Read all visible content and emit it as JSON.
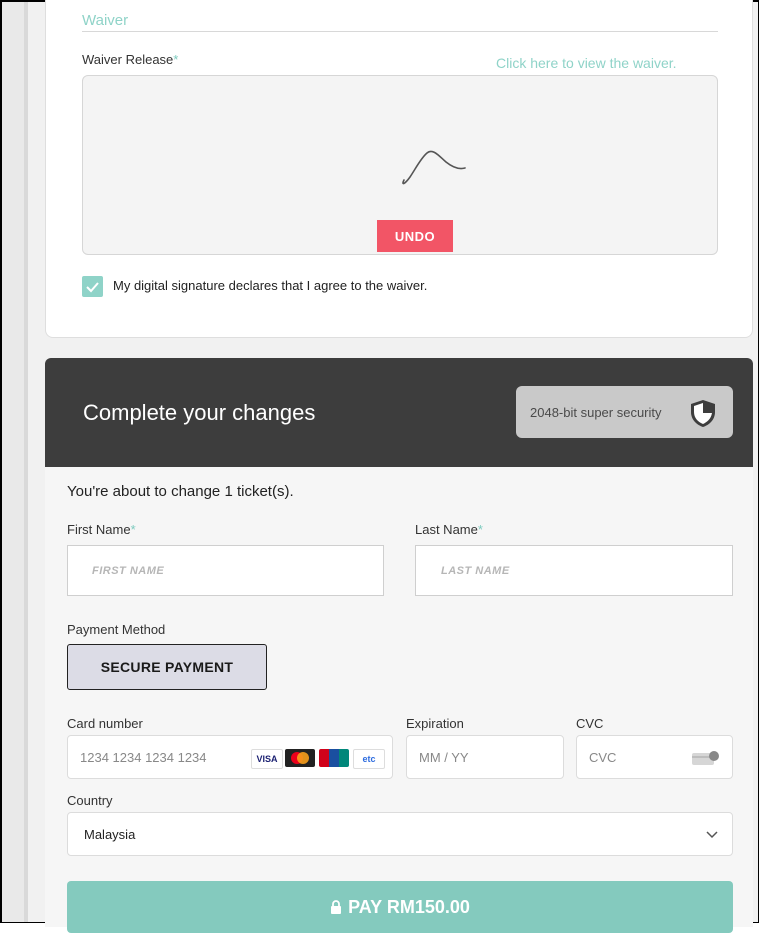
{
  "waiver": {
    "section_title": "Waiver",
    "release_label": "Waiver Release",
    "required_mark": "*",
    "view_link": "Click here to view the waiver.",
    "undo_label": "UNDO",
    "agree_label": "My digital signature declares that I agree to the waiver.",
    "agree_checked": true
  },
  "checkout": {
    "title": "Complete your changes",
    "security_badge": "2048-bit super security",
    "about_text": "You're about to change 1 ticket(s).",
    "first_name_label": "First Name",
    "first_name_placeholder": "FIRST NAME",
    "last_name_label": "Last Name",
    "last_name_placeholder": "LAST NAME",
    "payment_method_label": "Payment Method",
    "secure_payment_label": "SECURE PAYMENT",
    "card_number_label": "Card number",
    "card_number_placeholder": "1234 1234 1234 1234",
    "card_brands": [
      "VISA",
      "mastercard",
      "unionpay",
      "etc"
    ],
    "expiration_label": "Expiration",
    "expiration_placeholder": "MM / YY",
    "cvc_label": "CVC",
    "cvc_placeholder": "CVC",
    "country_label": "Country",
    "country_value": "Malaysia",
    "pay_label": "PAY RM150.00"
  },
  "colors": {
    "accent": "#84cabe",
    "undo": "#f25566",
    "dark_header": "#3d3d3d"
  }
}
